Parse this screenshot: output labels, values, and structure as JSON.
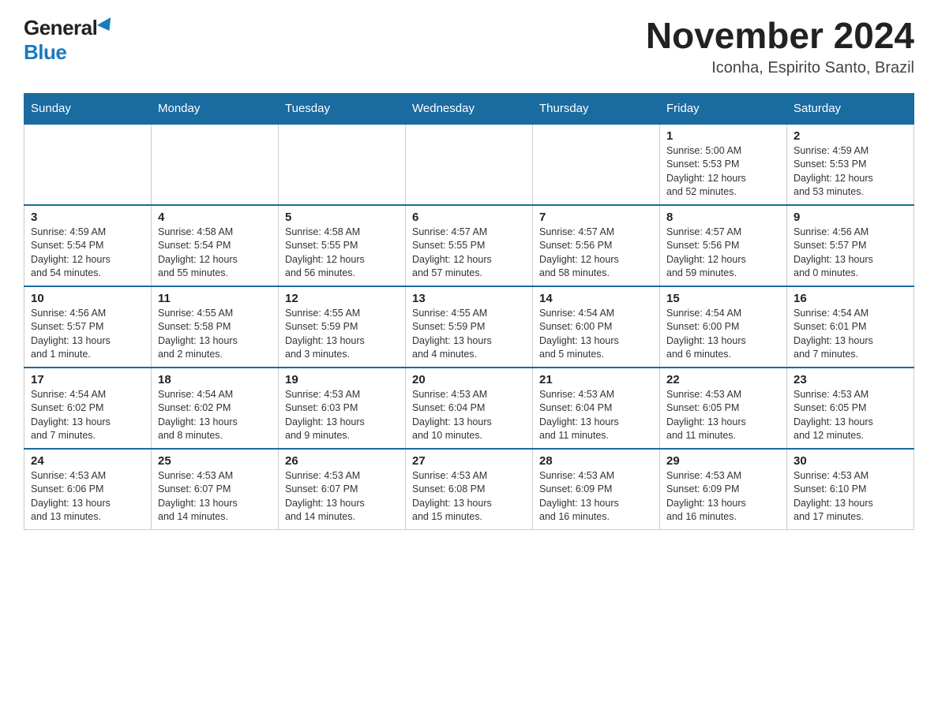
{
  "header": {
    "logo_general": "General",
    "logo_blue": "Blue",
    "month_title": "November 2024",
    "location": "Iconha, Espirito Santo, Brazil"
  },
  "weekdays": [
    "Sunday",
    "Monday",
    "Tuesday",
    "Wednesday",
    "Thursday",
    "Friday",
    "Saturday"
  ],
  "weeks": [
    [
      {
        "day": "",
        "info": ""
      },
      {
        "day": "",
        "info": ""
      },
      {
        "day": "",
        "info": ""
      },
      {
        "day": "",
        "info": ""
      },
      {
        "day": "",
        "info": ""
      },
      {
        "day": "1",
        "info": "Sunrise: 5:00 AM\nSunset: 5:53 PM\nDaylight: 12 hours\nand 52 minutes."
      },
      {
        "day": "2",
        "info": "Sunrise: 4:59 AM\nSunset: 5:53 PM\nDaylight: 12 hours\nand 53 minutes."
      }
    ],
    [
      {
        "day": "3",
        "info": "Sunrise: 4:59 AM\nSunset: 5:54 PM\nDaylight: 12 hours\nand 54 minutes."
      },
      {
        "day": "4",
        "info": "Sunrise: 4:58 AM\nSunset: 5:54 PM\nDaylight: 12 hours\nand 55 minutes."
      },
      {
        "day": "5",
        "info": "Sunrise: 4:58 AM\nSunset: 5:55 PM\nDaylight: 12 hours\nand 56 minutes."
      },
      {
        "day": "6",
        "info": "Sunrise: 4:57 AM\nSunset: 5:55 PM\nDaylight: 12 hours\nand 57 minutes."
      },
      {
        "day": "7",
        "info": "Sunrise: 4:57 AM\nSunset: 5:56 PM\nDaylight: 12 hours\nand 58 minutes."
      },
      {
        "day": "8",
        "info": "Sunrise: 4:57 AM\nSunset: 5:56 PM\nDaylight: 12 hours\nand 59 minutes."
      },
      {
        "day": "9",
        "info": "Sunrise: 4:56 AM\nSunset: 5:57 PM\nDaylight: 13 hours\nand 0 minutes."
      }
    ],
    [
      {
        "day": "10",
        "info": "Sunrise: 4:56 AM\nSunset: 5:57 PM\nDaylight: 13 hours\nand 1 minute."
      },
      {
        "day": "11",
        "info": "Sunrise: 4:55 AM\nSunset: 5:58 PM\nDaylight: 13 hours\nand 2 minutes."
      },
      {
        "day": "12",
        "info": "Sunrise: 4:55 AM\nSunset: 5:59 PM\nDaylight: 13 hours\nand 3 minutes."
      },
      {
        "day": "13",
        "info": "Sunrise: 4:55 AM\nSunset: 5:59 PM\nDaylight: 13 hours\nand 4 minutes."
      },
      {
        "day": "14",
        "info": "Sunrise: 4:54 AM\nSunset: 6:00 PM\nDaylight: 13 hours\nand 5 minutes."
      },
      {
        "day": "15",
        "info": "Sunrise: 4:54 AM\nSunset: 6:00 PM\nDaylight: 13 hours\nand 6 minutes."
      },
      {
        "day": "16",
        "info": "Sunrise: 4:54 AM\nSunset: 6:01 PM\nDaylight: 13 hours\nand 7 minutes."
      }
    ],
    [
      {
        "day": "17",
        "info": "Sunrise: 4:54 AM\nSunset: 6:02 PM\nDaylight: 13 hours\nand 7 minutes."
      },
      {
        "day": "18",
        "info": "Sunrise: 4:54 AM\nSunset: 6:02 PM\nDaylight: 13 hours\nand 8 minutes."
      },
      {
        "day": "19",
        "info": "Sunrise: 4:53 AM\nSunset: 6:03 PM\nDaylight: 13 hours\nand 9 minutes."
      },
      {
        "day": "20",
        "info": "Sunrise: 4:53 AM\nSunset: 6:04 PM\nDaylight: 13 hours\nand 10 minutes."
      },
      {
        "day": "21",
        "info": "Sunrise: 4:53 AM\nSunset: 6:04 PM\nDaylight: 13 hours\nand 11 minutes."
      },
      {
        "day": "22",
        "info": "Sunrise: 4:53 AM\nSunset: 6:05 PM\nDaylight: 13 hours\nand 11 minutes."
      },
      {
        "day": "23",
        "info": "Sunrise: 4:53 AM\nSunset: 6:05 PM\nDaylight: 13 hours\nand 12 minutes."
      }
    ],
    [
      {
        "day": "24",
        "info": "Sunrise: 4:53 AM\nSunset: 6:06 PM\nDaylight: 13 hours\nand 13 minutes."
      },
      {
        "day": "25",
        "info": "Sunrise: 4:53 AM\nSunset: 6:07 PM\nDaylight: 13 hours\nand 14 minutes."
      },
      {
        "day": "26",
        "info": "Sunrise: 4:53 AM\nSunset: 6:07 PM\nDaylight: 13 hours\nand 14 minutes."
      },
      {
        "day": "27",
        "info": "Sunrise: 4:53 AM\nSunset: 6:08 PM\nDaylight: 13 hours\nand 15 minutes."
      },
      {
        "day": "28",
        "info": "Sunrise: 4:53 AM\nSunset: 6:09 PM\nDaylight: 13 hours\nand 16 minutes."
      },
      {
        "day": "29",
        "info": "Sunrise: 4:53 AM\nSunset: 6:09 PM\nDaylight: 13 hours\nand 16 minutes."
      },
      {
        "day": "30",
        "info": "Sunrise: 4:53 AM\nSunset: 6:10 PM\nDaylight: 13 hours\nand 17 minutes."
      }
    ]
  ]
}
